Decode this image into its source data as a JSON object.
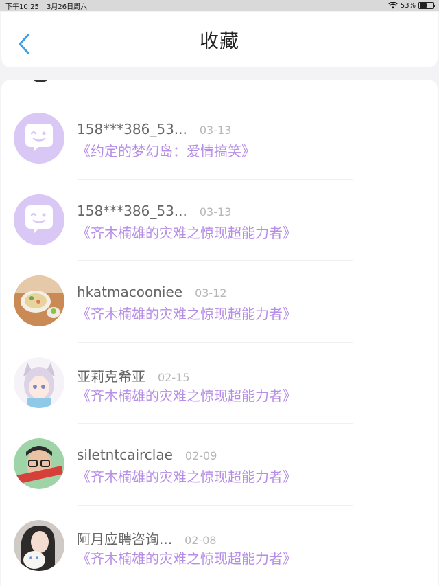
{
  "status_bar": {
    "time": "下午10:25",
    "date": "3月26日周六",
    "battery_percent": "53%",
    "battery_level": 0.53
  },
  "header": {
    "title": "收藏"
  },
  "colors": {
    "accent": "#3b9ee8",
    "title_purple": "#b68ee6",
    "avatar_purple": "#d9c8f6"
  },
  "favorites": [
    {
      "user": "158***386_53...",
      "date": "03-13",
      "title": "《约定的梦幻岛：爱情搞笑》",
      "avatar": "default-chat-avatar"
    },
    {
      "user": "158***386_53...",
      "date": "03-13",
      "title": "《齐木楠雄的灾难之惊现超能力者》",
      "avatar": "default-chat-avatar"
    },
    {
      "user": "hkatmacooniee",
      "date": "03-12",
      "title": "《齐木楠雄的灾难之惊现超能力者》",
      "avatar": "food-photo"
    },
    {
      "user": "亚莉克希亚",
      "date": "02-15",
      "title": "《齐木楠雄的灾难之惊现超能力者》",
      "avatar": "anime-girl"
    },
    {
      "user": "siletntcairclae",
      "date": "02-09",
      "title": "《齐木楠雄的灾难之惊现超能力者》",
      "avatar": "glasses-boy"
    },
    {
      "user": "阿月应聘咨询...",
      "date": "02-08",
      "title": "《齐木楠雄的灾难之惊现超能力者》",
      "avatar": "girl-with-cat"
    }
  ]
}
